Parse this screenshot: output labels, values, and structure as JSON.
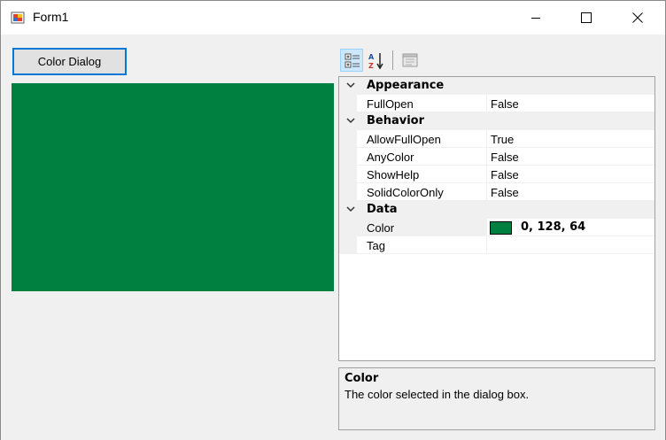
{
  "window": {
    "title": "Form1"
  },
  "main": {
    "color_button_label": "Color Dialog",
    "panel_color": "#008040"
  },
  "property_grid": {
    "toolbar": {
      "categorized_icon": "categorized-icon",
      "alphabetical_icon": "alphabetical-icon",
      "property_pages_icon": "property-pages-icon"
    },
    "categories": [
      {
        "label": "Appearance",
        "properties": [
          {
            "name": "FullOpen",
            "value": "False"
          }
        ]
      },
      {
        "label": "Behavior",
        "properties": [
          {
            "name": "AllowFullOpen",
            "value": "True"
          },
          {
            "name": "AnyColor",
            "value": "False"
          },
          {
            "name": "ShowHelp",
            "value": "False"
          },
          {
            "name": "SolidColorOnly",
            "value": "False"
          }
        ]
      },
      {
        "label": "Data",
        "properties": [
          {
            "name": "Color",
            "value": "0, 128, 64",
            "swatch": "#008040"
          },
          {
            "name": "Tag",
            "value": ""
          }
        ]
      }
    ],
    "help": {
      "title": "Color",
      "description": "The color selected in the dialog box."
    }
  }
}
